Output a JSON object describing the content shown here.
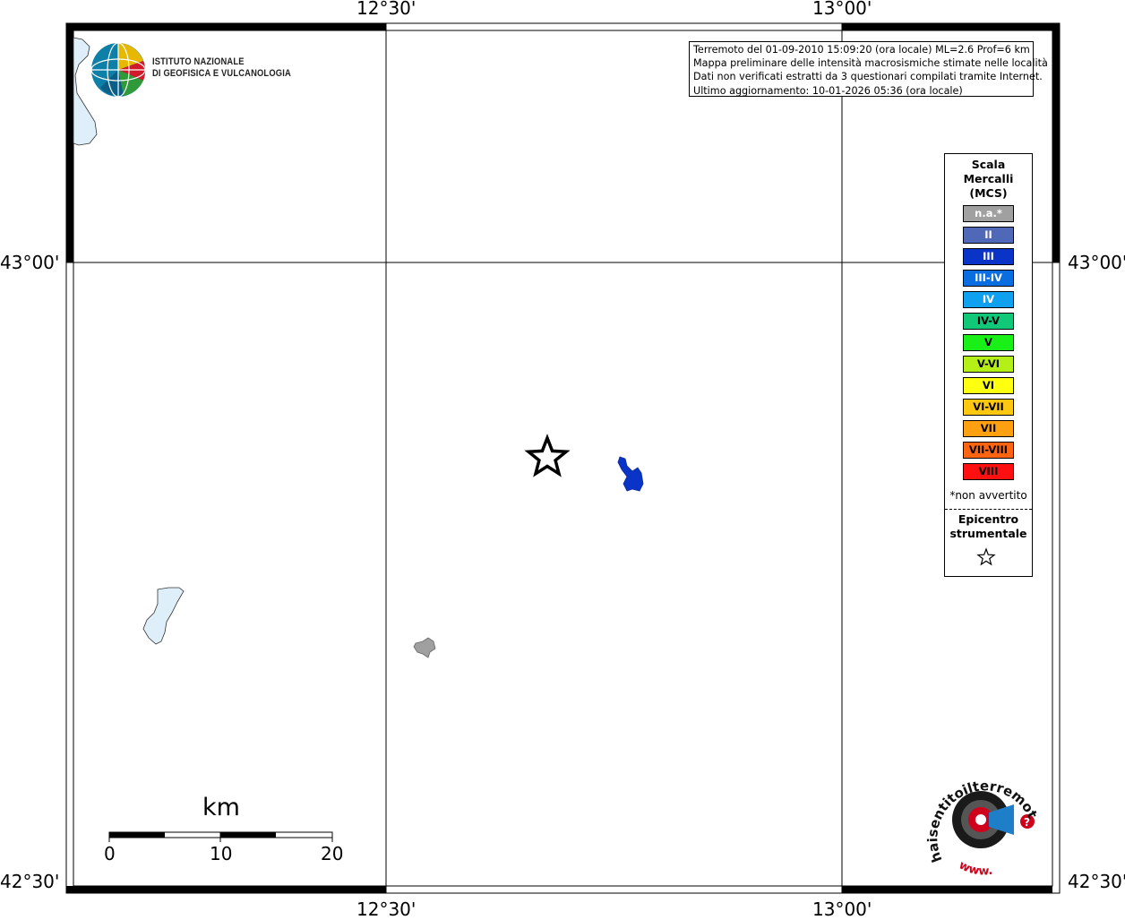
{
  "map": {
    "lon_labels_top": [
      "12°30'",
      "13°00'"
    ],
    "lon_labels_bottom": [
      "12°30'",
      "13°00'"
    ],
    "lat_labels_left": [
      "43°00'",
      "42°30'"
    ],
    "lat_labels_right": [
      "43°00'",
      "42°30'"
    ]
  },
  "info_box": {
    "line1": "Terremoto del 01-09-2010 15:09:20 (ora locale) ML=2.6 Prof=6 km",
    "line2": "Mappa preliminare delle intensità macrosismiche stimate nelle località",
    "line3": "Dati non verificati estratti da 3 questionari compilati tramite Internet.",
    "line4": "Ultimo aggiornamento: 10-01-2026 05:36 (ora locale)"
  },
  "logo": {
    "line1": "ISTITUTO NAZIONALE",
    "line2": "DI GEOFISICA E VULCANOLOGIA"
  },
  "legend": {
    "title1": "Scala",
    "title2": "Mercalli",
    "title3": "(MCS)",
    "classes": [
      {
        "label": "n.a.*",
        "color": "#a0a0a0",
        "text": "#ffffff"
      },
      {
        "label": "II",
        "color": "#5068b8",
        "text": "#ffffff"
      },
      {
        "label": "III",
        "color": "#0a34c8",
        "text": "#ffffff"
      },
      {
        "label": "III-IV",
        "color": "#0a6ee0",
        "text": "#ffffff"
      },
      {
        "label": "IV",
        "color": "#10a0f0",
        "text": "#ffffff"
      },
      {
        "label": "IV-V",
        "color": "#10c878",
        "text": "#000000"
      },
      {
        "label": "V",
        "color": "#18f018",
        "text": "#000000"
      },
      {
        "label": "V-VI",
        "color": "#b4f018",
        "text": "#000000"
      },
      {
        "label": "VI",
        "color": "#ffff10",
        "text": "#000000"
      },
      {
        "label": "VI-VII",
        "color": "#ffc810",
        "text": "#000000"
      },
      {
        "label": "VII",
        "color": "#ffa010",
        "text": "#000000"
      },
      {
        "label": "VII-VIII",
        "color": "#ff6410",
        "text": "#000000"
      },
      {
        "label": "VIII",
        "color": "#ff1010",
        "text": "#000000"
      }
    ],
    "note": "*non avvertito",
    "epicentre1": "Epicentro",
    "epicentre2": "strumentale"
  },
  "scale_bar": {
    "unit": "km",
    "labels": [
      "0",
      "10",
      "20"
    ]
  },
  "localities": [
    {
      "intensity": "III",
      "color": "#0a34c8"
    },
    {
      "intensity": "n.a.*",
      "color": "#a0a0a0"
    }
  ],
  "watermark": {
    "text": "haisentitoilterremoto.it",
    "url": "www."
  },
  "colors": {
    "lake": "#dfeffa",
    "frame": "#000000"
  }
}
